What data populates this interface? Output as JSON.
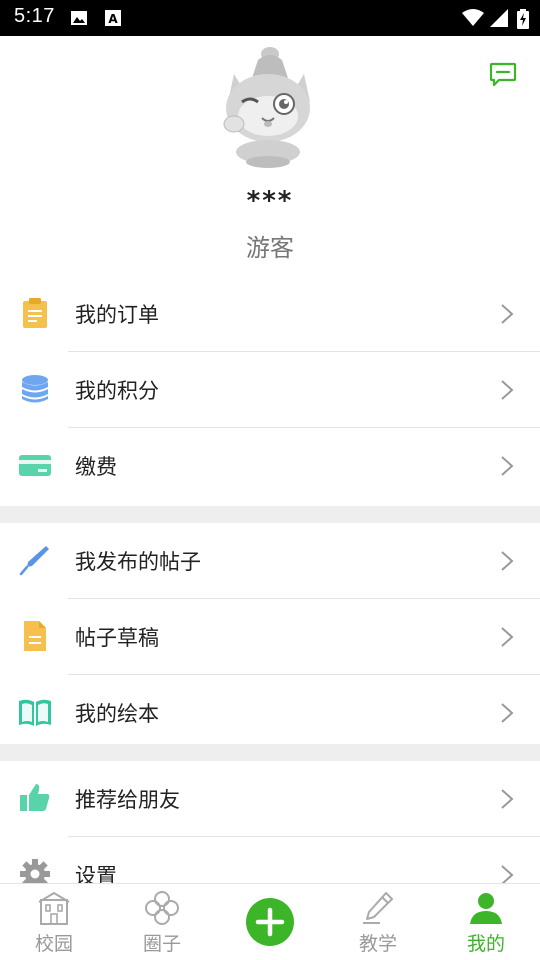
{
  "status_bar": {
    "time": "5:17",
    "icons": [
      "image-icon",
      "a-badge-icon",
      "wifi-icon",
      "signal-icon",
      "battery-charging-icon"
    ]
  },
  "header": {
    "message_icon": "message-icon",
    "avatar": "cat-mascot-avatar",
    "username": "***",
    "role": "游客"
  },
  "menu": {
    "sections": [
      [
        {
          "label": "我的订单",
          "icon": "clipboard-icon",
          "color": "#f5c04d"
        },
        {
          "label": "我的积分",
          "icon": "coins-stack-icon",
          "color": "#6fa6f0"
        },
        {
          "label": "缴费",
          "icon": "card-icon",
          "color": "#59d3a9"
        }
      ],
      [
        {
          "label": "我发布的帖子",
          "icon": "pen-icon",
          "color": "#5b93e8"
        },
        {
          "label": "帖子草稿",
          "icon": "document-icon",
          "color": "#f5c04d"
        },
        {
          "label": "我的绘本",
          "icon": "book-icon",
          "color": "#2fc6a0"
        }
      ],
      [
        {
          "label": "推荐给朋友",
          "icon": "thumbs-up-icon",
          "color": "#59d3a9"
        },
        {
          "label": "设置",
          "icon": "gear-icon",
          "color": "#999999"
        }
      ]
    ]
  },
  "bottom_nav": {
    "items": [
      {
        "label": "校园",
        "icon": "campus-icon"
      },
      {
        "label": "圈子",
        "icon": "clover-icon"
      },
      {
        "label": "",
        "icon": "add-icon"
      },
      {
        "label": "教学",
        "icon": "pencil-icon"
      },
      {
        "label": "我的",
        "icon": "person-icon"
      }
    ],
    "active_index": 4,
    "accent_color": "#3cb528"
  }
}
